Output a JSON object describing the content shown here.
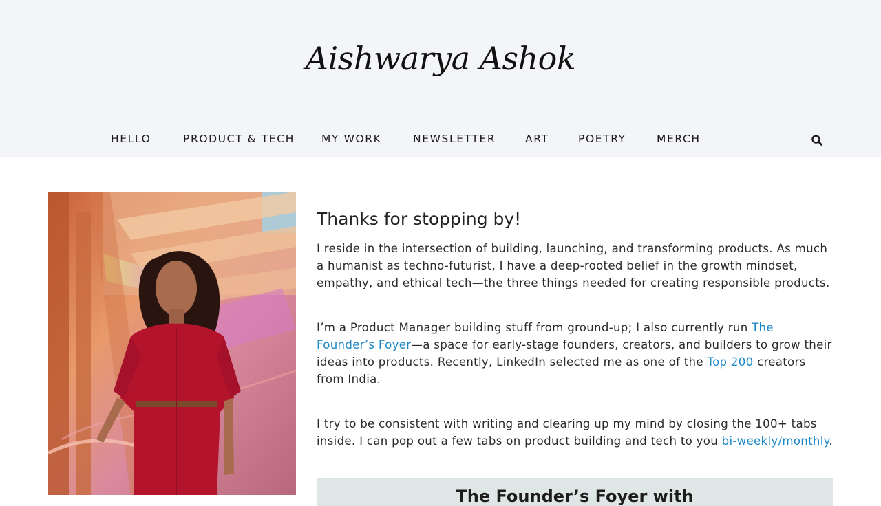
{
  "site": {
    "logo_text": "Aishwarya Ashok"
  },
  "nav": {
    "items": [
      {
        "label": "HELLO"
      },
      {
        "label": "PRODUCT & TECH"
      },
      {
        "label": "MY WORK"
      },
      {
        "label": "NEWSLETTER"
      },
      {
        "label": "ART"
      },
      {
        "label": "POETRY"
      },
      {
        "label": "MERCH"
      }
    ],
    "search_icon": "search-icon"
  },
  "main": {
    "heading": "Thanks for stopping by!",
    "p1": "I reside in the intersection of building, launching, and transforming products. As much a humanist as techno-futurist, I have a deep-rooted belief in the growth mindset, empathy, and ethical tech—the three things needed for creating responsible products.",
    "p2": {
      "part1": "I’m a Product Manager building stuff from ground-up; I also currently run ",
      "link1": "The Founder’s Foyer",
      "part2": "—a space for early-stage founders, creators, and builders to grow their ideas into products. Recently, LinkedIn selected me as one of the ",
      "link2": "Top 200",
      "part3": " creators from India."
    },
    "p3": {
      "part1": "I try to be consistent with writing and clearing up my mind by closing the 100+ tabs inside. I can pop out a few tabs on product building and tech to you ",
      "link1": "bi-weekly/monthly",
      "part2": "."
    },
    "newsletter_box_title": "The Founder’s Foyer with"
  },
  "colors": {
    "header_bg": "#f4f5f8",
    "link": "#1e88c7",
    "box_bg": "#dfe6e6"
  }
}
